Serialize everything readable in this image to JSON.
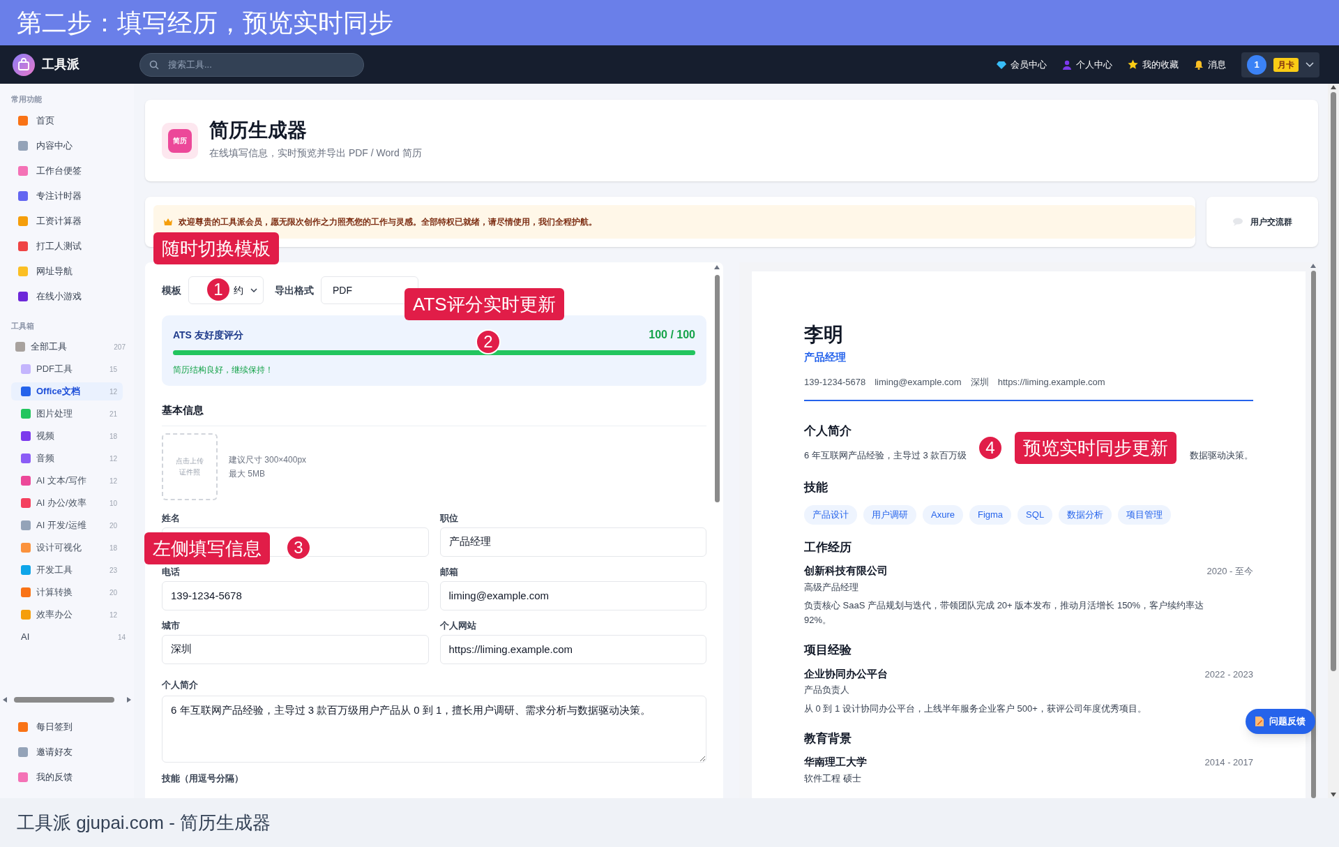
{
  "banner": {
    "title": "第二步：填写经历，预览实时同步"
  },
  "navbar": {
    "brand": "工具派",
    "search": {
      "placeholder": "搜索工具..."
    },
    "links": [
      {
        "label": "会员中心"
      },
      {
        "label": "个人中心"
      },
      {
        "label": "我的收藏"
      },
      {
        "label": "消息"
      }
    ],
    "user": {
      "avatar": "1",
      "badge": "月卡"
    }
  },
  "sidebar": {
    "sections": [
      {
        "title": "常用功能",
        "items": [
          {
            "label": "首页",
            "selected": false
          },
          {
            "label": "内容中心",
            "selected": false
          },
          {
            "label": "工作台便签",
            "selected": false
          },
          {
            "label": "专注计时器",
            "selected": false
          },
          {
            "label": "工资计算器",
            "selected": false
          },
          {
            "label": "打工人测试",
            "selected": false
          },
          {
            "label": "网址导航",
            "selected": false
          },
          {
            "label": "在线小游戏",
            "selected": false
          }
        ]
      },
      {
        "title": "工具箱",
        "items": [
          {
            "label": "全部工具",
            "count": "207",
            "kind": "tool",
            "selected": false,
            "children": [
              {
                "label": "PDF工具",
                "count": "15",
                "selected": false
              },
              {
                "label": "Office文档",
                "count": "12",
                "selected": true
              },
              {
                "label": "图片处理",
                "count": "21",
                "selected": false
              },
              {
                "label": "视频",
                "count": "18",
                "selected": false
              },
              {
                "label": "音频",
                "count": "12",
                "selected": false
              },
              {
                "label": "AI 文本/写作",
                "count": "12",
                "selected": false
              },
              {
                "label": "AI 办公/效率",
                "count": "10",
                "selected": false
              },
              {
                "label": "AI 开发/运维",
                "count": "20",
                "selected": false
              },
              {
                "label": "设计可视化",
                "count": "18",
                "selected": false
              },
              {
                "label": "开发工具",
                "count": "23",
                "selected": false
              },
              {
                "label": "计算转换",
                "count": "20",
                "selected": false
              },
              {
                "label": "效率办公",
                "count": "12",
                "selected": false
              }
            ]
          },
          {
            "label": "AI",
            "count": "14",
            "kind": "plain",
            "selected": false
          }
        ]
      }
    ],
    "bottom_items": [
      {
        "label": "每日签到"
      },
      {
        "label": "邀请好友"
      },
      {
        "label": "我的反馈"
      }
    ]
  },
  "header": {
    "badge": "简历",
    "title": "简历生成器",
    "subtitle": "在线填写信息，实时预览并导出 PDF / Word 简历"
  },
  "notice": {
    "text": "欢迎尊贵的工具派会员，愿无限次创作之力照亮您的工作与灵感。全部特权已就绪，请尽情使用，我们全程护航。",
    "group_button": "用户交流群"
  },
  "form": {
    "template": {
      "label": "模板",
      "value": "约"
    },
    "export": {
      "label": "导出格式",
      "value": "PDF"
    },
    "ats": {
      "title": "ATS 友好度评分",
      "score": "100 / 100",
      "level": 1,
      "message": "简历结构良好，继续保持！"
    },
    "section_title": "基本信息",
    "photo": {
      "upload": [
        "点击上传",
        "证件照"
      ],
      "hints": [
        "建议尺寸 300×400px",
        "最大 5MB"
      ]
    },
    "fields": [
      {
        "label": "姓名"
      },
      {
        "label": "职位",
        "value": "产品经理"
      },
      {
        "label": "电话",
        "value": "139-1234-5678"
      },
      {
        "label": "邮箱",
        "value": "liming@example.com"
      },
      {
        "label": "城市",
        "value": "深圳"
      },
      {
        "label": "个人网站",
        "value": "https://liming.example.com"
      }
    ],
    "summary": {
      "label": "个人简介",
      "value": "6 年互联网产品经验，主导过 3 款百万级用户产品从 0 到 1，擅长用户调研、需求分析与数据驱动决策。"
    },
    "next_label": "技能（用逗号分隔）"
  },
  "preview": {
    "name": "李明",
    "title": "产品经理",
    "contact": [
      "139-1234-5678",
      "liming@example.com",
      "深圳",
      "https://liming.example.com"
    ],
    "summary_title": "个人简介",
    "summary_parts": [
      "6 年互联网产品经验，主导过 3 款百万级",
      "数据驱动决策。"
    ],
    "skills_title": "技能",
    "skills": [
      "产品设计",
      "用户调研",
      "Axure",
      "Figma",
      "SQL",
      "数据分析",
      "项目管理"
    ],
    "work_title": "工作经历",
    "work": [
      {
        "name": "创新科技有限公司",
        "period": "2020 - 至今",
        "role": "高级产品经理",
        "desc": "负责核心 SaaS 产品规划与迭代，带领团队完成 20+ 版本发布，推动月活增长 150%，客户续约率达 92%。"
      }
    ],
    "project_title": "项目经验",
    "projects": [
      {
        "name": "企业协同办公平台",
        "period": "2022 - 2023",
        "role": "产品负责人",
        "desc": "从 0 到 1 设计协同办公平台，上线半年服务企业客户 500+，获评公司年度优秀项目。"
      }
    ],
    "education_title": "教育背景",
    "education": [
      {
        "name": "华南理工大学",
        "period": "2014 - 2017",
        "role": "软件工程 硕士"
      }
    ]
  },
  "feedback_button": "问题反馈",
  "footer": {
    "caption": "工具派 gjupai.com - 简历生成器"
  },
  "callouts": [
    {
      "number": "1",
      "text": "随时切换模板"
    },
    {
      "number": "2",
      "text": "ATS评分实时更新"
    },
    {
      "number": "3",
      "text": "左侧填写信息"
    },
    {
      "number": "4",
      "text": "预览实时同步更新"
    }
  ]
}
